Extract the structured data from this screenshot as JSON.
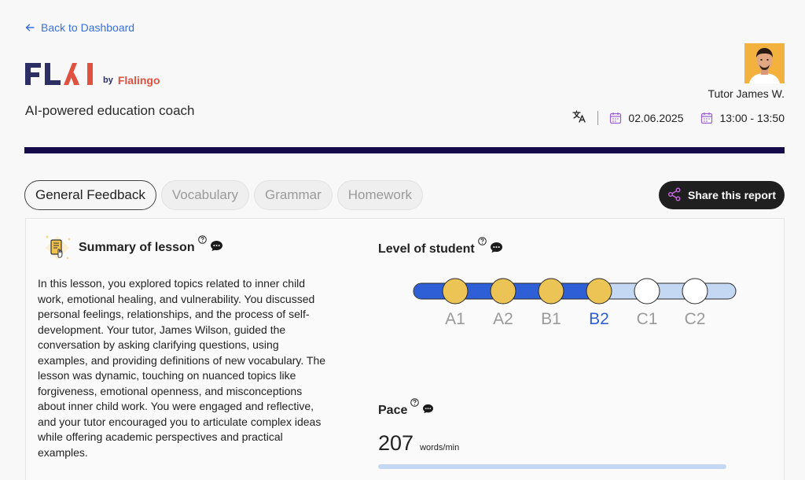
{
  "nav": {
    "back_label": "Back to Dashboard"
  },
  "brand": {
    "by": "by",
    "name": "Flalingo",
    "tagline": "AI-powered education coach"
  },
  "tutor": {
    "name": "Tutor James W."
  },
  "lesson_meta": {
    "date": "02.06.2025",
    "time": "13:00 - 13:50"
  },
  "tabs": [
    {
      "label": "General Feedback",
      "active": true
    },
    {
      "label": "Vocabulary",
      "active": false
    },
    {
      "label": "Grammar",
      "active": false
    },
    {
      "label": "Homework",
      "active": false
    }
  ],
  "share": {
    "label": "Share this report"
  },
  "summary": {
    "title": "Summary of lesson",
    "text": "In this lesson, you explored topics related to inner child work, emotional healing, and vulnerability. You discussed personal feelings, relationships, and the process of self-development. Your tutor, James Wilson, guided the conversation by asking clarifying questions, using examples, and providing definitions of new vocabulary. The lesson was dynamic, touching on nuanced topics like forgiveness, emotional openness, and misconceptions about inner child work. You were engaged and reflective, and your tutor encouraged you to articulate complex ideas while offering academic perspectives and practical examples."
  },
  "level": {
    "title": "Level of student",
    "levels": [
      "A1",
      "A2",
      "B1",
      "B2",
      "C1",
      "C2"
    ],
    "current": "B2",
    "colors": {
      "filled": "#2f5fd6",
      "empty": "#c5d8f3",
      "dot_filled": "#ebc455",
      "current_label": "#2f5fd6",
      "label": "#9a9a9a"
    }
  },
  "pace": {
    "title": "Pace",
    "value": "207",
    "unit": "words/min"
  },
  "colors": {
    "accent": "#3a6fd8",
    "divider": "#150a4a",
    "share_bg": "#1f1f1f",
    "share_icon": "#c66be0",
    "calendar_icon": "#9b5fd6"
  }
}
